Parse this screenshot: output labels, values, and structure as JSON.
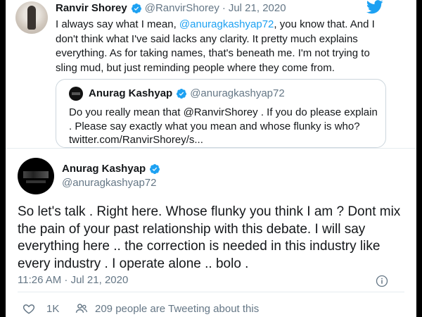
{
  "top_tweet": {
    "name": "Ranvir Shorey",
    "handle": "@RanvirShorey",
    "separator": "·",
    "date": "Jul 21, 2020",
    "text_parts": [
      "I always say what I mean, ",
      "@anuragkashyap72",
      ", you know that. And I don't think what I've said lacks any clarity. It pretty much explains everything. As for taking names, that's beneath me. I'm not trying to sling mud, but just reminding people where they come from."
    ]
  },
  "quoted_tweet": {
    "name": "Anurag Kashyap",
    "handle": "@anuragkashyap72",
    "text": "Do you really mean that @RanvirShorey . If you do please explain . Please say exactly what you mean and whose flunky is who? twitter.com/RanvirShorey/s..."
  },
  "main_tweet": {
    "name": "Anurag Kashyap",
    "handle": "@anuragkashyap72",
    "text": "So let's talk . Right here. Whose flunky you think I am ? Dont mix the pain of your past relationship with this debate. I will say everything here .. the correction is needed in this industry like every industry . I operate alone .. bolo .",
    "timestamp": "11:26 AM · Jul 21, 2020",
    "like_count": "1K",
    "people_tweeting": "209 people are Tweeting about this"
  },
  "icons": [
    "verified-icon",
    "twitter-bird-icon",
    "info-icon",
    "heart-icon",
    "people-icon"
  ],
  "colors": {
    "accent": "#1da1f2",
    "text": "#14171a",
    "muted": "#657786",
    "border": "#ccd6dd"
  }
}
